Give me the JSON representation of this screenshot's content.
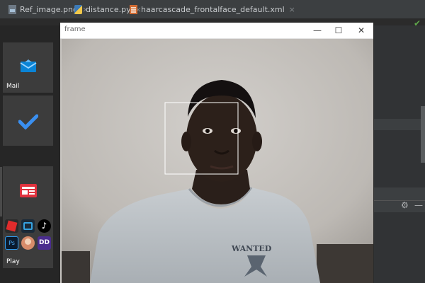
{
  "ide": {
    "tabs": [
      {
        "label": "Ref_image.png",
        "icon": "image-file-icon",
        "close": "×"
      },
      {
        "label": "distance.py",
        "icon": "python-file-icon",
        "close": "×"
      },
      {
        "label": "haarcascade_frontalface_default.xml",
        "icon": "xml-file-icon",
        "close": "×"
      }
    ],
    "status_check": "✔"
  },
  "start_tiles": {
    "mail": {
      "label": "Mail",
      "icon": "mail-icon"
    },
    "todo": {
      "icon": "todo-check-icon"
    },
    "news": {
      "icon": "news-icon"
    },
    "play": {
      "label": "Play",
      "apps": [
        {
          "name": "roblox-icon",
          "text": ""
        },
        {
          "name": "prime-video-icon",
          "text": ""
        },
        {
          "name": "tiktok-icon",
          "text": "♪"
        },
        {
          "name": "photoshop-express-icon",
          "text": "Ps"
        },
        {
          "name": "picsart-icon",
          "text": ""
        },
        {
          "name": "dolby-icon",
          "text": "DD"
        }
      ]
    }
  },
  "cv_window": {
    "title": "frame",
    "minimize": "—",
    "maximize": "☐",
    "close": "✕",
    "detections": [
      {
        "label": "face",
        "color": "#ffffff"
      }
    ],
    "shirt_text": "WANTED"
  },
  "colors": {
    "ide_background": "#2b2b2b",
    "tile_background": "#3c3c3c",
    "accent_blue": "#0a84d6",
    "bounding_box": "#ffffff"
  }
}
